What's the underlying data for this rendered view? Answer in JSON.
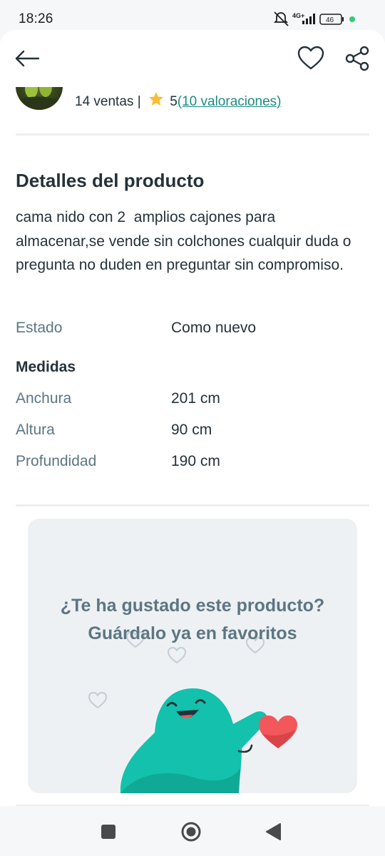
{
  "status_bar": {
    "time": "18:26",
    "network": "4G+",
    "battery": "46"
  },
  "header": {
    "back_icon": "arrow-left-icon",
    "favorite_icon": "heart-outline-icon",
    "share_icon": "share-icon"
  },
  "seller": {
    "sales": "14 ventas",
    "separator": "|",
    "rating": "5",
    "reviews_link": "(10 valoraciones)",
    "star_color": "#fdbb32"
  },
  "details": {
    "title": "Detalles del producto",
    "description": "cama nido con 2  amplios cajones para almacenar,se vende sin colchones cualquir duda o pregunta no duden en preguntar sin compromiso.",
    "condition": {
      "label": "Estado",
      "value": "Como nuevo"
    },
    "measures_heading": "Medidas",
    "measures": [
      {
        "label": "Anchura",
        "value": "201 cm"
      },
      {
        "label": "Altura",
        "value": "90 cm"
      },
      {
        "label": "Profundidad",
        "value": "190 cm"
      }
    ]
  },
  "promo": {
    "line1": "¿Te ha gustado este producto?",
    "line2": "Guárdalo ya en favoritos",
    "mascot_color": "#13c1ac",
    "heart_color": "#f2575b"
  },
  "navigation": {
    "recents_icon": "square-icon",
    "home_icon": "circle-home-icon",
    "back_icon": "triangle-back-icon"
  }
}
